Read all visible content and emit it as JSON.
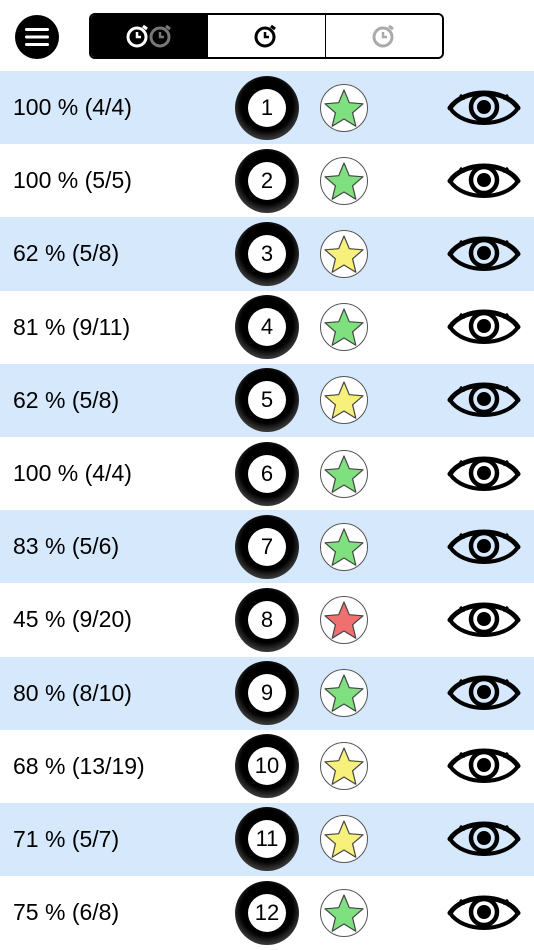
{
  "toolbar": {
    "menu_icon": "hamburger-menu-icon",
    "segments": [
      {
        "icon": "double-alarm-clock-icon",
        "selected": true
      },
      {
        "icon": "alarm-clock-icon",
        "selected": false
      },
      {
        "icon": "alarm-clock-gray-icon",
        "selected": false
      }
    ]
  },
  "colors": {
    "row_alt_bg": "#d6e8fb",
    "star_green": "#7fe07f",
    "star_yellow": "#f7f07a",
    "star_red": "#f07070"
  },
  "rows": [
    {
      "percent": "100 % (4/4)",
      "number": "1",
      "star": "green",
      "action_icon": "eye-icon"
    },
    {
      "percent": "100 % (5/5)",
      "number": "2",
      "star": "green",
      "action_icon": "eye-icon"
    },
    {
      "percent": "62 % (5/8)",
      "number": "3",
      "star": "yellow",
      "action_icon": "eye-icon"
    },
    {
      "percent": "81 % (9/11)",
      "number": "4",
      "star": "green",
      "action_icon": "eye-icon"
    },
    {
      "percent": "62 % (5/8)",
      "number": "5",
      "star": "yellow",
      "action_icon": "eye-icon"
    },
    {
      "percent": "100 % (4/4)",
      "number": "6",
      "star": "green",
      "action_icon": "eye-icon"
    },
    {
      "percent": "83 % (5/6)",
      "number": "7",
      "star": "green",
      "action_icon": "eye-icon"
    },
    {
      "percent": "45 % (9/20)",
      "number": "8",
      "star": "red",
      "action_icon": "eye-icon"
    },
    {
      "percent": "80 % (8/10)",
      "number": "9",
      "star": "green",
      "action_icon": "eye-icon"
    },
    {
      "percent": "68 % (13/19)",
      "number": "10",
      "star": "yellow",
      "action_icon": "eye-icon"
    },
    {
      "percent": "71 % (5/7)",
      "number": "11",
      "star": "yellow",
      "action_icon": "eye-icon"
    },
    {
      "percent": "75 % (6/8)",
      "number": "12",
      "star": "green",
      "action_icon": "eye-icon"
    }
  ]
}
